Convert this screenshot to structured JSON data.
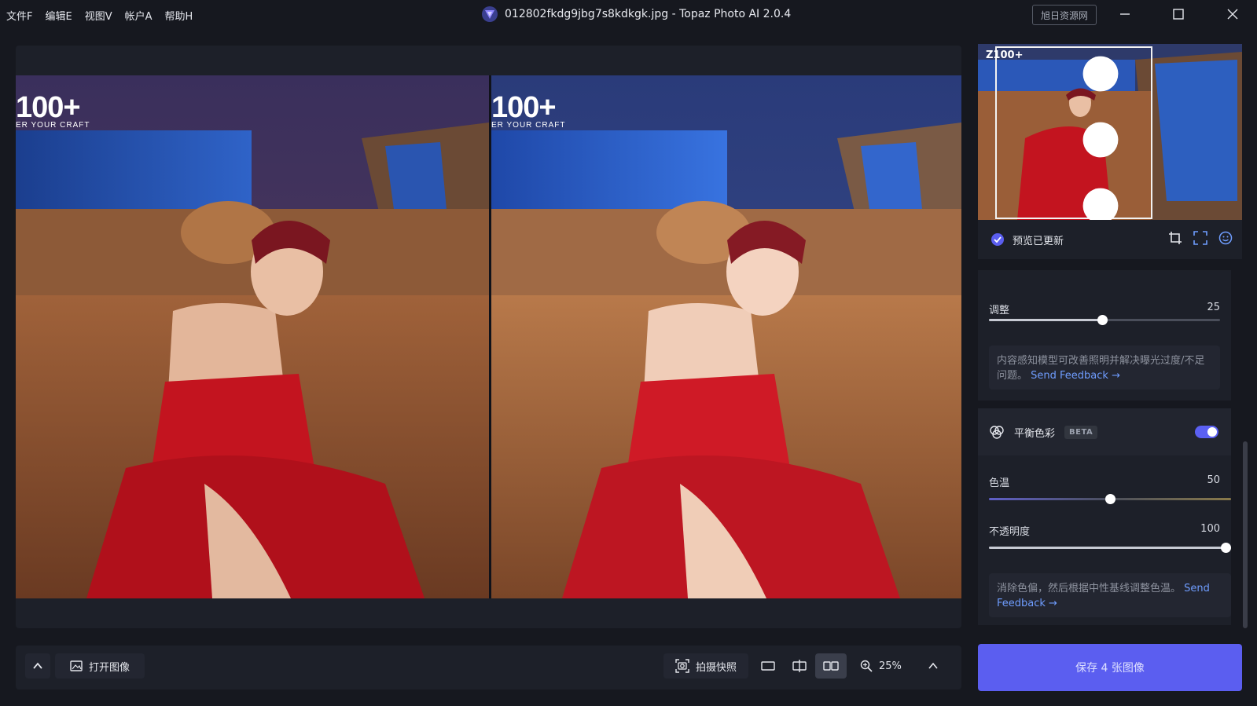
{
  "menu": [
    "文件F",
    "编辑E",
    "视图V",
    "帐户A",
    "帮助H"
  ],
  "window": {
    "title": "012802fkdg9jbg7s8kdkgk.jpg - Topaz Photo AI 2.0.4",
    "badge": "旭日资源网"
  },
  "watermark": {
    "big": "100+",
    "small": "ER YOUR CRAFT"
  },
  "thumb_watermark": "Z100+",
  "preview": {
    "status": "预览已更新"
  },
  "adjust": {
    "label": "调整",
    "value": "25",
    "value_fraction": 0.49,
    "note": "内容感知模型可改善照明并解决曝光过度/不足问题。",
    "note_link": "Send Feedback →"
  },
  "balance": {
    "title": "平衡色彩",
    "badge": "BETA",
    "enabled": true,
    "temp_label": "色温",
    "temp_value": "50",
    "temp_fraction": 0.5,
    "opacity_label": "不透明度",
    "opacity_value": "100",
    "opacity_fraction": 1.0,
    "note": "消除色偏，然后根据中性基线调整色温。",
    "note_link": "Send Feedback →"
  },
  "toolbar": {
    "open_image": "打开图像",
    "snapshot": "拍摄快照",
    "zoom": "25%"
  },
  "save_button": "保存 4 张图像",
  "colors": {
    "accent": "#5b5ef0",
    "link": "#6f9dff",
    "bg": "#16181f",
    "panel": "#1d2029"
  }
}
